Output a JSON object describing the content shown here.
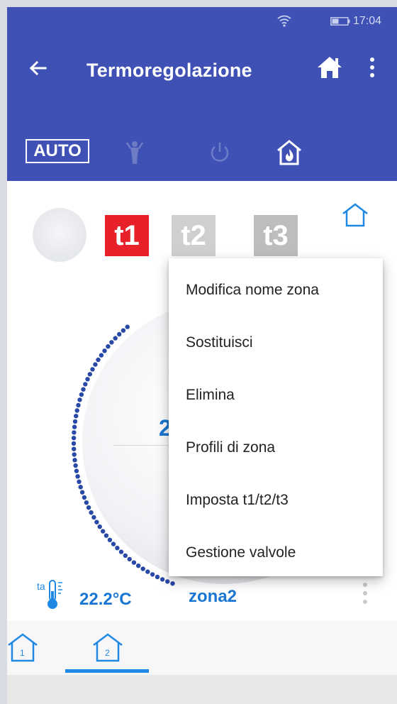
{
  "status_bar": {
    "time": "17:04",
    "icons": [
      "wifi-icon",
      "battery-icon"
    ]
  },
  "app_bar": {
    "title": "Termoregolazione",
    "icons": [
      "back-arrow-icon",
      "home-icon",
      "more-vertical-icon"
    ]
  },
  "mode_bar": {
    "auto_label": "AUTO",
    "icons": [
      "manual-person-icon",
      "power-icon",
      "house-flame-icon"
    ]
  },
  "temperature_chips": [
    {
      "label": "t1",
      "color": "#e8202a"
    },
    {
      "label": "t2",
      "color": "#cfcfcf"
    },
    {
      "label": "t3",
      "color": "#bdbdbd"
    }
  ],
  "dial": {
    "value_partial": "2",
    "accent_color": "#2849a6"
  },
  "readout": {
    "ambient_label": "ta",
    "ambient_temperature": "22.2°C",
    "zone_name": "zona2"
  },
  "zone_tabs": [
    {
      "label": "1",
      "selected": false
    },
    {
      "label": "2",
      "selected": true
    }
  ],
  "context_menu": {
    "items": [
      "Modifica nome zona",
      "Sostituisci",
      "Elimina",
      "Profili di zona",
      "Imposta t1/t2/t3",
      "Gestione valvole"
    ]
  },
  "colors": {
    "primary": "#3f51b5",
    "accent_blue": "#1976d2",
    "red": "#e8202a"
  }
}
